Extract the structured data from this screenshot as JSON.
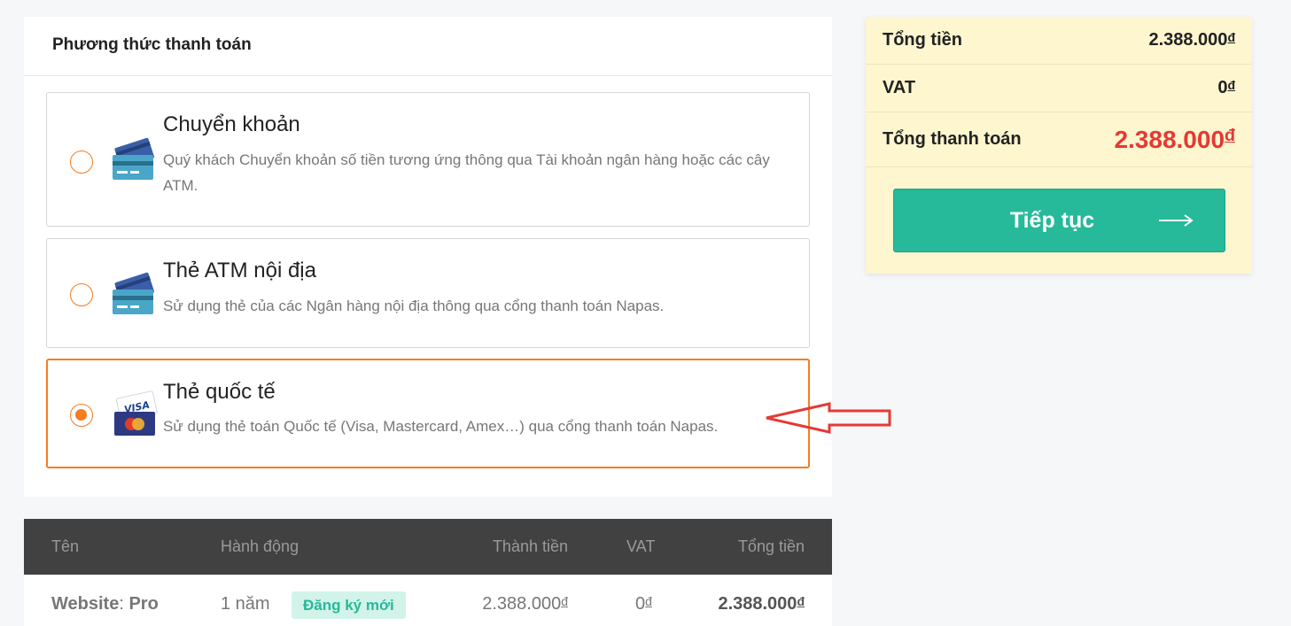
{
  "payment": {
    "title": "Phương thức thanh toán",
    "options": [
      {
        "name": "Chuyển khoản",
        "desc": "Quý khách Chuyển khoản số tiền tương ứng thông qua Tài khoản ngân hàng hoặc các cây ATM.",
        "icon": "bank-card-icon",
        "selected": false
      },
      {
        "name": "Thẻ ATM nội địa",
        "desc": "Sử dụng thẻ của các Ngân hàng nội địa thông qua cổng thanh toán Napas.",
        "icon": "bank-card-icon",
        "selected": false
      },
      {
        "name": "Thẻ quốc tế",
        "desc": "Sử dụng thẻ toán Quốc tế (Visa, Mastercard, Amex…) qua cổng thanh toán Napas.",
        "icon": "visa-mastercard-icon",
        "selected": true
      }
    ]
  },
  "summary": {
    "subtotal_label": "Tổng tiền",
    "subtotal_value": "2.388.000",
    "vat_label": "VAT",
    "vat_value": "0",
    "total_label": "Tổng thanh toán",
    "total_value": "2.388.000",
    "currency": "đ",
    "continue_label": "Tiếp tục"
  },
  "table": {
    "headers": [
      "Tên",
      "Hành động",
      "Thành tiền",
      "VAT",
      "Tổng tiền"
    ],
    "rows": [
      {
        "name_prefix": "Website",
        "name_plan": "Pro",
        "duration": "1 năm",
        "action": "Đăng ký mới",
        "amount": "2.388.000",
        "vat": "0",
        "total": "2.388.000"
      }
    ]
  },
  "colors": {
    "accent_orange": "#f57c1f",
    "primary_green": "#26b99a",
    "total_red": "#e53935",
    "summary_bg": "#fdf6cf",
    "table_header_bg": "#414141",
    "annotation_arrow": "#e53935"
  }
}
